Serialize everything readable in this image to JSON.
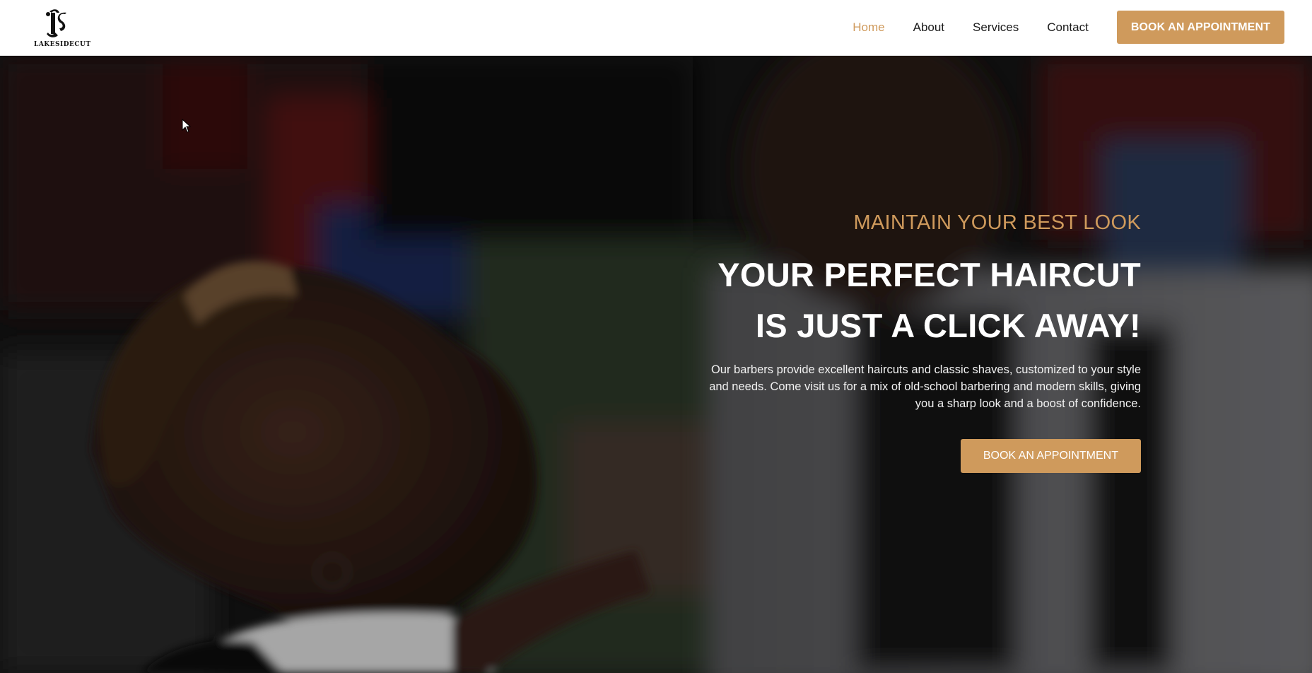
{
  "brand": {
    "logo_monogram": "LS",
    "logo_text": "LAKESIDECUT"
  },
  "nav": {
    "items": [
      {
        "label": "Home",
        "active": true
      },
      {
        "label": "About",
        "active": false
      },
      {
        "label": "Services",
        "active": false
      },
      {
        "label": "Contact",
        "active": false
      }
    ],
    "cta_label": "BOOK AN APPOINTMENT"
  },
  "hero": {
    "eyebrow": "MAINTAIN YOUR BEST LOOK",
    "headline_line1": "YOUR PERFECT HAIRCUT",
    "headline_line2": "IS JUST A CLICK AWAY!",
    "description": "Our barbers provide excellent haircuts and classic shaves, customized to your style and needs. Come visit us for a mix of old-school barbering and modern skills, giving you a sharp look and a boost of confidence.",
    "cta_label": "BOOK AN APPOINTMENT"
  },
  "colors": {
    "accent": "#cf9a5c",
    "header_bg": "#ffffff",
    "text_dark": "#1a1a1a",
    "hero_text": "#ffffff"
  },
  "icons": {
    "cursor": "mouse-pointer-icon",
    "logo": "barbershop-logo-icon"
  }
}
